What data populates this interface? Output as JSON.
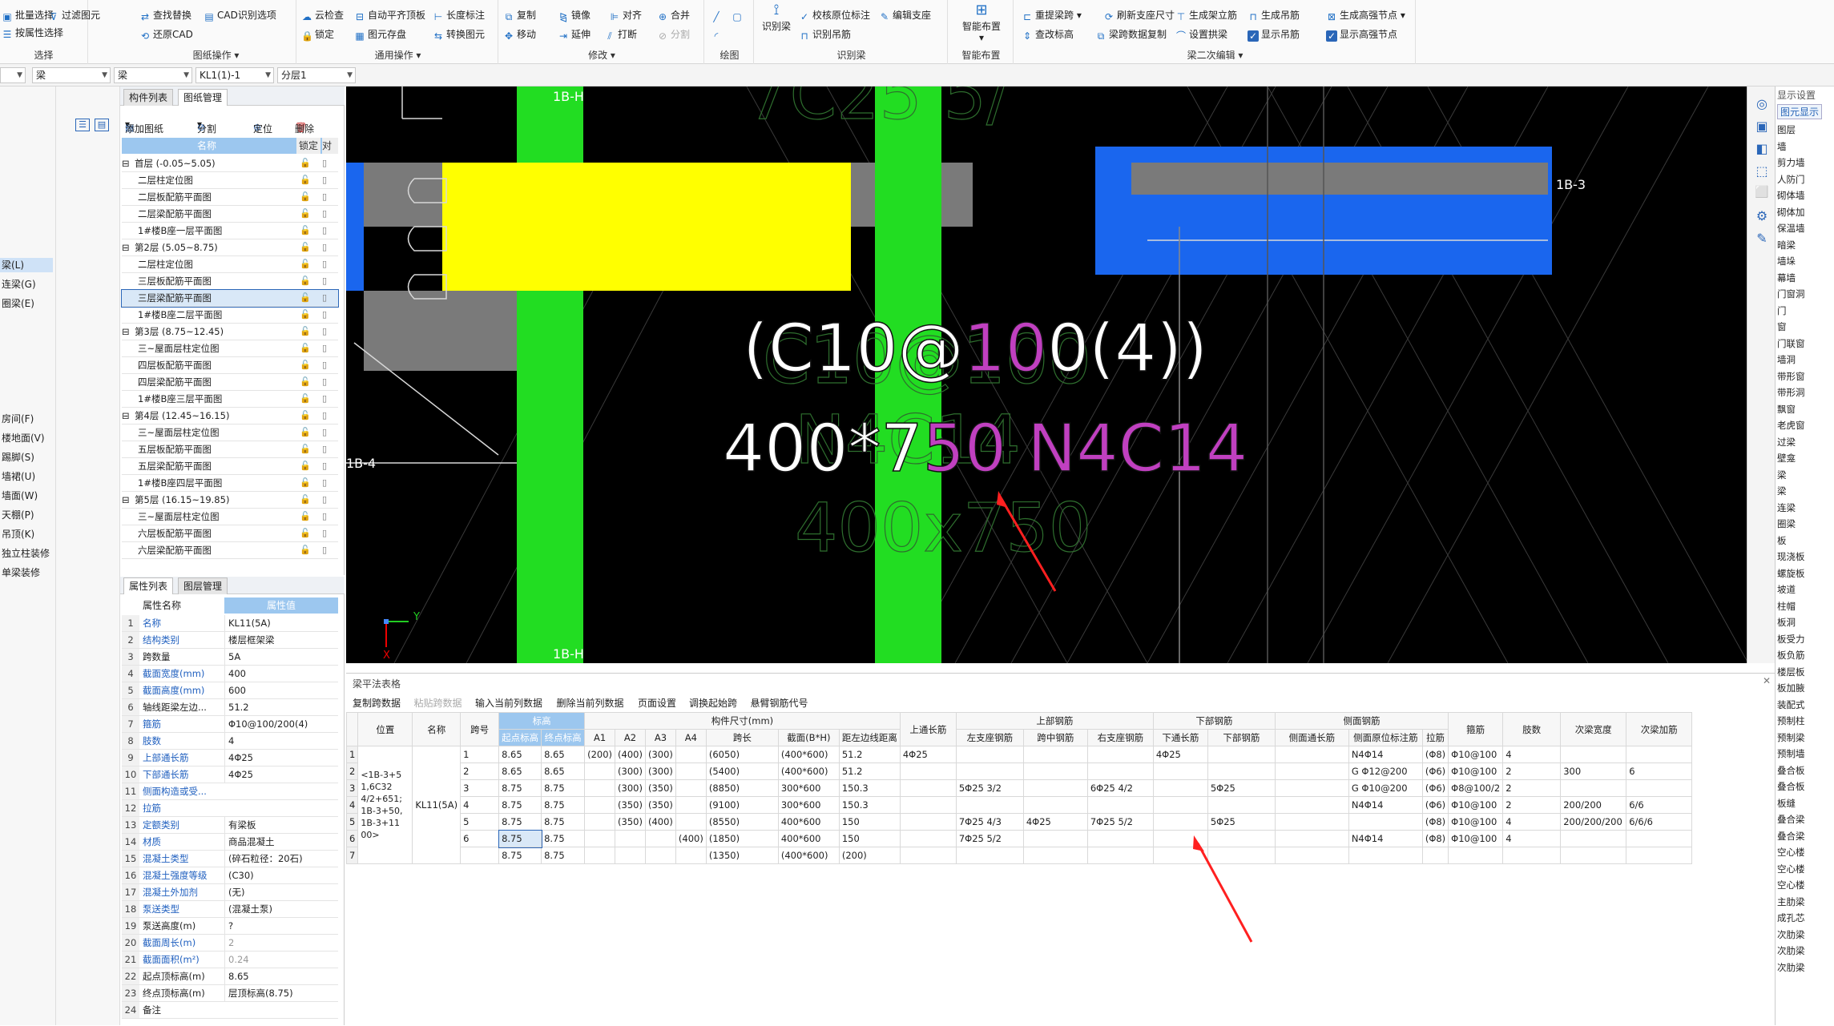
{
  "ribbon": {
    "groups": [
      {
        "title": "选择",
        "items": [
          "批量选择",
          "过滤图元",
          "按属性选择"
        ]
      },
      {
        "title": "图纸操作",
        "items": [
          "查找替换",
          "CAD识别选项",
          "还原CAD"
        ]
      },
      {
        "title": "通用操作",
        "items": [
          "云检查",
          "自动平齐顶板",
          "长度标注",
          "锁定",
          "图元存盘",
          "转换图元"
        ]
      },
      {
        "title": "修改",
        "items": [
          "复制",
          "镜像",
          "对齐",
          "合并",
          "移动",
          "延伸",
          "打断",
          "分割"
        ]
      },
      {
        "title": "绘图",
        "items": []
      },
      {
        "title": "识别梁",
        "items": [
          "识别梁",
          "校核原位标注",
          "编辑支座",
          "识别吊筋"
        ]
      },
      {
        "title": "智能布置",
        "items": [
          "智能布置"
        ]
      },
      {
        "title": "梁二次编辑",
        "items": [
          "重提梁跨",
          "刷新支座尺寸",
          "生成架立筋",
          "生成吊筋",
          "生成高强节点",
          "查改标高",
          "梁跨数据复制",
          "设置拱梁",
          "显示吊筋",
          "显示高强节点"
        ]
      }
    ]
  },
  "selbar": {
    "c1": "",
    "c2": "梁",
    "c3": "梁",
    "c4": "KL1(1)-1",
    "c5": "分层1"
  },
  "leftnav": [
    "梁(L)",
    "连梁(G)",
    "圈梁(E)",
    "房间(F)",
    "楼地面(V)",
    "踢脚(S)",
    "墙裙(U)",
    "墙面(W)",
    "天棚(P)",
    "吊顶(K)",
    "独立柱装修",
    "单梁装修"
  ],
  "drawpanel": {
    "tabs": [
      "构件列表",
      "图纸管理"
    ],
    "toolbar": [
      "添加图纸",
      "分割",
      "定位",
      "删除"
    ],
    "head_name": "名称",
    "head_lock": "锁定",
    "head_extra": "对",
    "rows": [
      {
        "t": "首层 (-0.05~5.05)",
        "g": true
      },
      {
        "t": "二层柱定位图",
        "g": false
      },
      {
        "t": "二层板配筋平面图",
        "g": false
      },
      {
        "t": "二层梁配筋平面图",
        "g": false
      },
      {
        "t": "1#楼B座一层平面图",
        "g": false
      },
      {
        "t": "第2层 (5.05~8.75)",
        "g": true
      },
      {
        "t": "二层柱定位图",
        "g": false
      },
      {
        "t": "三层板配筋平面图",
        "g": false
      },
      {
        "t": "三层梁配筋平面图",
        "g": false,
        "sel": true
      },
      {
        "t": "1#楼B座二层平面图",
        "g": false
      },
      {
        "t": "第3层 (8.75~12.45)",
        "g": true
      },
      {
        "t": "三~屋面层柱定位图",
        "g": false
      },
      {
        "t": "四层板配筋平面图",
        "g": false
      },
      {
        "t": "四层梁配筋平面图",
        "g": false
      },
      {
        "t": "1#楼B座三层平面图",
        "g": false
      },
      {
        "t": "第4层 (12.45~16.15)",
        "g": true
      },
      {
        "t": "三~屋面层柱定位图",
        "g": false
      },
      {
        "t": "五层板配筋平面图",
        "g": false
      },
      {
        "t": "五层梁配筋平面图",
        "g": false
      },
      {
        "t": "1#楼B座四层平面图",
        "g": false
      },
      {
        "t": "第5层 (16.15~19.85)",
        "g": true
      },
      {
        "t": "三~屋面层柱定位图",
        "g": false
      },
      {
        "t": "六层板配筋平面图",
        "g": false
      },
      {
        "t": "六层梁配筋平面图",
        "g": false
      }
    ]
  },
  "proppanel": {
    "tabs": [
      "属性列表",
      "图层管理"
    ],
    "head_name": "属性名称",
    "head_value": "属性值",
    "rows": [
      {
        "n": "1",
        "k": "名称",
        "v": "KL11(5A)",
        "b": true
      },
      {
        "n": "2",
        "k": "结构类别",
        "v": "楼层框架梁",
        "b": true
      },
      {
        "n": "3",
        "k": "跨数量",
        "v": "5A",
        "b": false
      },
      {
        "n": "4",
        "k": "截面宽度(mm)",
        "v": "400",
        "b": true
      },
      {
        "n": "5",
        "k": "截面高度(mm)",
        "v": "600",
        "b": true
      },
      {
        "n": "6",
        "k": "轴线距梁左边...",
        "v": "51.2",
        "b": false
      },
      {
        "n": "7",
        "k": "箍筋",
        "v": "Φ10@100/200(4)",
        "b": true
      },
      {
        "n": "8",
        "k": "肢数",
        "v": "4",
        "b": true
      },
      {
        "n": "9",
        "k": "上部通长筋",
        "v": "4Φ25",
        "b": true
      },
      {
        "n": "10",
        "k": "下部通长筋",
        "v": "4Φ25",
        "b": true
      },
      {
        "n": "11",
        "k": "侧面构造或受...",
        "v": "",
        "b": true
      },
      {
        "n": "12",
        "k": "拉筋",
        "v": "",
        "b": true
      },
      {
        "n": "13",
        "k": "定额类别",
        "v": "有梁板",
        "b": true
      },
      {
        "n": "14",
        "k": "材质",
        "v": "商品混凝土",
        "b": true
      },
      {
        "n": "15",
        "k": "混凝土类型",
        "v": "(碎石粒径：20石)",
        "b": true
      },
      {
        "n": "16",
        "k": "混凝土强度等级",
        "v": "(C30)",
        "b": true
      },
      {
        "n": "17",
        "k": "混凝土外加剂",
        "v": "(无)",
        "b": true
      },
      {
        "n": "18",
        "k": "泵送类型",
        "v": "(混凝土泵)",
        "b": true
      },
      {
        "n": "19",
        "k": "泵送高度(m)",
        "v": "?",
        "b": false
      },
      {
        "n": "20",
        "k": "截面周长(m)",
        "v": "2",
        "b": true,
        "grey": true
      },
      {
        "n": "21",
        "k": "截面面积(m²)",
        "v": "0.24",
        "b": true,
        "grey": true
      },
      {
        "n": "22",
        "k": "起点顶标高(m)",
        "v": "8.65",
        "b": false
      },
      {
        "n": "23",
        "k": "终点顶标高(m)",
        "v": "层顶标高(8.75)",
        "b": false
      },
      {
        "n": "24",
        "k": "备注",
        "v": "",
        "b": false
      }
    ]
  },
  "canvas": {
    "axis_top": "1B-H",
    "axis_bottom": "1B-H",
    "axis_right": "1B-3",
    "axis_left": "1B-4",
    "label_line1_a": "(C10@",
    "label_line1_b": "10",
    "label_line1_c": "0(4))",
    "label_line2_a": "400*7",
    "label_line2_b": "50 N4C14",
    "ghost_1": "C10@100",
    "ghost_2": "N4C14",
    "ghost_3": "400x750",
    "ghost_top": "7C25 5/",
    "ucs_y": "Y",
    "ucs_x": "X"
  },
  "rightpanel": {
    "title": "显示设置",
    "tab": "图元显示",
    "items": [
      "图层",
      "墙",
      "剪力墙",
      "人防门",
      "砌体墙",
      "砌体加",
      "保温墙",
      "暗梁",
      "墙垛",
      "幕墙",
      "门窗洞",
      "门",
      "窗",
      "门联窗",
      "墙洞",
      "带形窗",
      "带形洞",
      "飘窗",
      "老虎窗",
      "过梁",
      "壁龛",
      "梁",
      "梁",
      "连梁",
      "圈梁",
      "板",
      "现浇板",
      "螺旋板",
      "坡道",
      "柱帽",
      "板洞",
      "板受力",
      "板负筋",
      "楼层板",
      "板加腋",
      "装配式",
      "预制柱",
      "预制梁",
      "预制墙",
      "叠合板",
      "叠合板",
      "板缝",
      "叠合梁",
      "叠合梁",
      "空心楼",
      "空心楼",
      "空心楼",
      "主肋梁",
      "成孔芯",
      "次肋梁",
      "次肋梁",
      "次肋梁"
    ]
  },
  "bottom": {
    "title": "梁平法表格",
    "buttons": [
      {
        "t": "复制跨数据",
        "dis": false
      },
      {
        "t": "粘贴跨数据",
        "dis": true
      },
      {
        "t": "输入当前列数据",
        "dis": false
      },
      {
        "t": "删除当前列数据",
        "dis": false
      },
      {
        "t": "页面设置",
        "dis": false
      },
      {
        "t": "调换起始跨",
        "dis": false
      },
      {
        "t": "悬臂钢筋代号",
        "dis": false
      }
    ],
    "h1": [
      "位置",
      "名称",
      "跨号",
      "标高",
      "构件尺寸(mm)",
      "上通长筋",
      "上部钢筋",
      "下部钢筋",
      "侧面钢筋",
      "箍筋",
      "肢数",
      "次梁宽度",
      "次梁加筋"
    ],
    "h2": [
      "起点标高",
      "终点标高",
      "A1",
      "A2",
      "A3",
      "A4",
      "跨长",
      "截面(B*H)",
      "距左边线距离",
      "左支座钢筋",
      "跨中钢筋",
      "右支座钢筋",
      "下通长筋",
      "下部钢筋",
      "侧面通长筋",
      "侧面原位标注筋",
      "拉筋"
    ],
    "position_text": "<1B-3+5 1,6C32 4/2+651; 1B-3+50, 1B-3+11 00>",
    "name_text": "KL11(5A)",
    "rownums": [
      "1",
      "2",
      "3",
      "4",
      "5",
      "6",
      "7"
    ],
    "rows": [
      [
        "1",
        "8.65",
        "8.65",
        "(200)",
        "(400)",
        "(300)",
        "",
        "(6050)",
        "(400*600)",
        "51.2",
        "4Φ25",
        "",
        "",
        "",
        "4Φ25",
        "",
        "",
        "N4Φ14",
        "(Φ8)",
        "Φ10@100",
        "4",
        "",
        ""
      ],
      [
        "2",
        "8.65",
        "8.65",
        "",
        "(300)",
        "(300)",
        "",
        "(5400)",
        "(400*600)",
        "51.2",
        "",
        "",
        "",
        "",
        "",
        "",
        "",
        "G Φ12@200",
        "(Φ6)",
        "Φ10@100",
        "2",
        "300",
        "6"
      ],
      [
        "3",
        "8.75",
        "8.75",
        "",
        "(300)",
        "(350)",
        "",
        "(8850)",
        "300*600",
        "150.3",
        "",
        "5Φ25 3/2",
        "",
        "6Φ25 4/2",
        "",
        "5Φ25",
        "",
        "G Φ10@200",
        "(Φ6)",
        "Φ8@100/2",
        "2",
        "",
        ""
      ],
      [
        "4",
        "8.75",
        "8.75",
        "",
        "(350)",
        "(350)",
        "",
        "(9100)",
        "300*600",
        "150.3",
        "",
        "",
        "",
        "",
        "",
        "",
        "",
        "N4Φ14",
        "(Φ6)",
        "Φ10@100",
        "2",
        "200/200",
        "6/6"
      ],
      [
        "5",
        "8.75",
        "8.75",
        "",
        "(350)",
        "(400)",
        "",
        "(8550)",
        "400*600",
        "150",
        "",
        "7Φ25 4/3",
        "4Φ25",
        "7Φ25 5/2",
        "",
        "5Φ25",
        "",
        "",
        "(Φ8)",
        "Φ10@100",
        "4",
        "200/200/200",
        "6/6/6"
      ],
      [
        "6",
        "8.75",
        "8.75",
        "",
        "",
        "",
        "(400)",
        "(1850)",
        "400*600",
        "150",
        "",
        "7Φ25 5/2",
        "",
        "",
        "",
        "",
        "",
        "N4Φ14",
        "(Φ8)",
        "Φ10@100",
        "4",
        "",
        ""
      ],
      [
        "",
        "8.75",
        "8.75",
        "",
        "",
        "",
        "",
        "(1350)",
        "(400*600)",
        "(200)",
        "",
        "",
        "",
        "",
        "",
        "",
        "",
        "",
        "",
        "",
        "",
        "",
        ""
      ]
    ]
  },
  "colors": {
    "yellow": "#ffff00",
    "green": "#22dd22",
    "blue": "#1a66ee",
    "magenta": "#c040c0",
    "arrow": "#ff2020"
  }
}
